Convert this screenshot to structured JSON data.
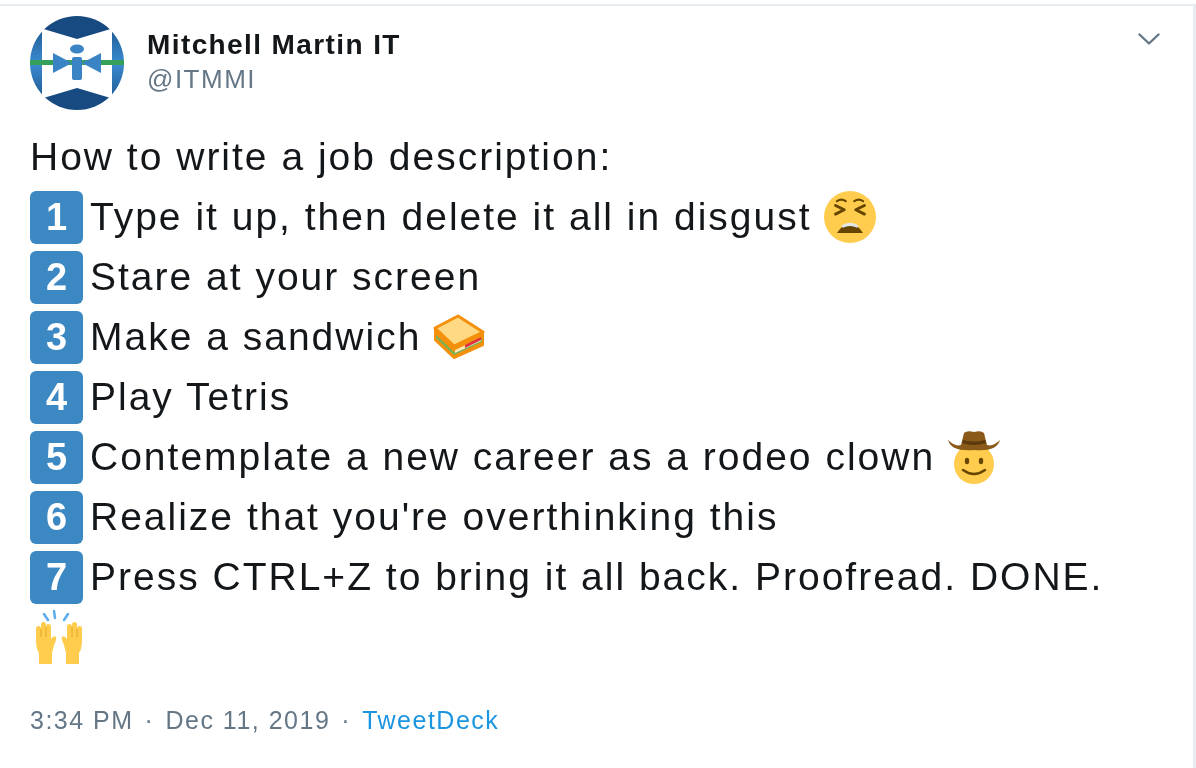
{
  "tweet": {
    "author": {
      "name": "Mitchell Martin IT",
      "handle": "@ITMMI"
    },
    "intro": "How to write a job description:",
    "steps": [
      {
        "number": "1",
        "text": "Type it up, then delete it all in disgust",
        "kind": "tired"
      },
      {
        "number": "2",
        "text": "Stare at your screen",
        "kind": "plain"
      },
      {
        "number": "3",
        "text": "Make a sandwich",
        "kind": "sandwich"
      },
      {
        "number": "4",
        "text": "Play Tetris",
        "kind": "plain"
      },
      {
        "number": "5",
        "text": "Contemplate a new career as a rodeo clown",
        "kind": "cowboy"
      },
      {
        "number": "6",
        "text": "Realize that you're overthinking this",
        "kind": "plain"
      },
      {
        "number": "7",
        "text": "Press CTRL+Z to bring it all back. Proofread. DONE.",
        "kind": "plain"
      }
    ],
    "footer": [
      {
        "kind": "time",
        "text": "3:34 PM"
      },
      {
        "kind": "separator",
        "text": "·"
      },
      {
        "kind": "date",
        "text": "Dec 11, 2019"
      },
      {
        "kind": "separator",
        "text": "·"
      },
      {
        "kind": "link",
        "text": "TweetDeck"
      }
    ]
  }
}
